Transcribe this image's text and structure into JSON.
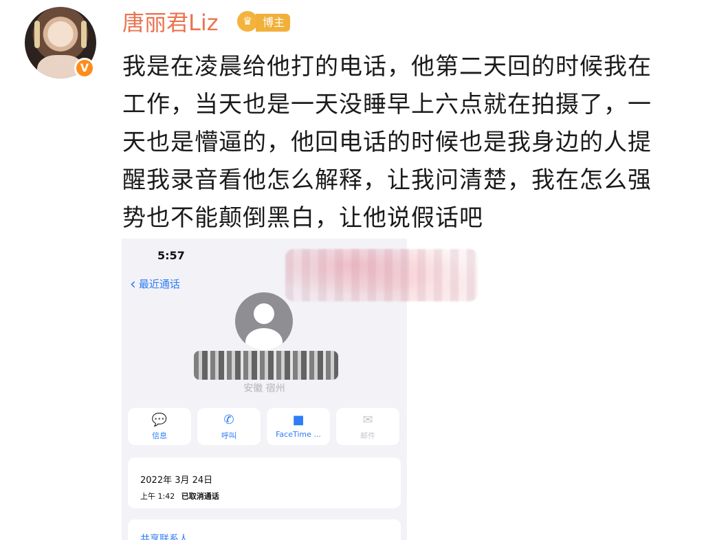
{
  "user": {
    "name": "唐丽君Liz",
    "tag": "博主",
    "verified_badge": "V"
  },
  "post": {
    "lines": [
      "我是在凌晨给他打的电话，他第二天回的时候我在",
      "工作，当天也是一天没睡早上六点就在拍摄了，一",
      "天也是懵逼的，他回电话的时候也是我身边的人提",
      "醒我录音看他怎么解释，让我问清楚，我在怎么强",
      "势也不能颠倒黑白，让他说假话吧"
    ]
  },
  "screenshot": {
    "status_time": "5:57",
    "back_label": "最近通话",
    "location": "安徽 宿州",
    "actions": [
      {
        "label": "信息",
        "icon": "message-icon"
      },
      {
        "label": "呼叫",
        "icon": "phone-icon"
      },
      {
        "label": "FaceTime ...",
        "icon": "video-icon"
      },
      {
        "label": "邮件",
        "icon": "mail-icon"
      }
    ],
    "call_date": "2022年 3月 24日",
    "call_time": "上午 1:42",
    "call_status": "已取消通话",
    "share_contact": "共享联系人"
  },
  "colors": {
    "username": "#eb7350",
    "ios_blue": "#2e7cf6",
    "badge_orange": "#ff8c1a"
  }
}
